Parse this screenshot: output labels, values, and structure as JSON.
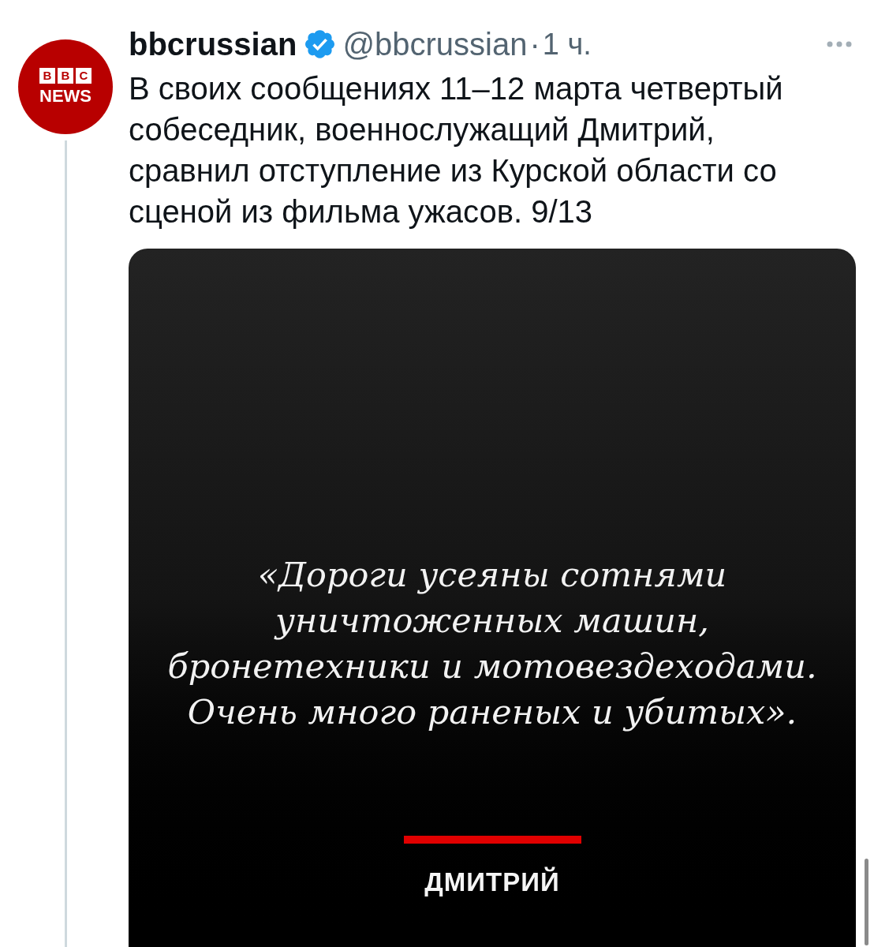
{
  "tweet": {
    "avatar": {
      "logo_blocks": [
        "B",
        "B",
        "C"
      ],
      "logo_text": "NEWS"
    },
    "display_name": "bbcrussian",
    "verified": true,
    "handle": "@bbcrussian",
    "separator": "·",
    "time": "1 ч.",
    "text": "В своих сообщениях 11–12 марта четвертый собеседник, военнослужащий Дмитрий, сравнил отступление из Курской области со сценой из фильма ужасов. 9/13",
    "media_card": {
      "quote": "«Дороги усеяны сотнями уничтоженных машин, бронетехники и мотовездеходами. Очень много раненых и убитых».",
      "attribution": "ДМИТРИЙ"
    }
  }
}
